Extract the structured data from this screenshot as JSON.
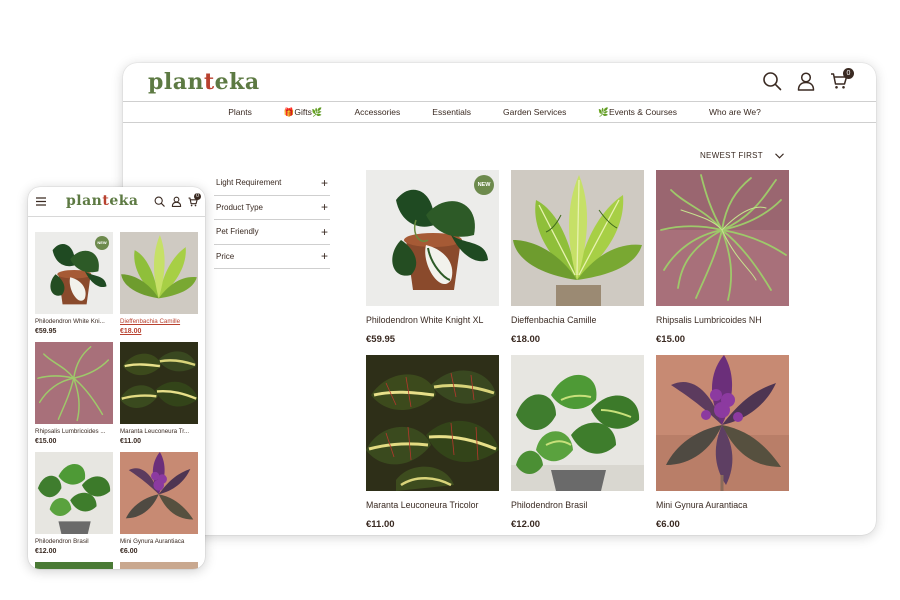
{
  "brand": {
    "name_part1": "plan",
    "name_accent": "t",
    "name_part2": "eka",
    "color_green": "#5d7a43",
    "color_accent": "#b8412f"
  },
  "header": {
    "cart_count": "0"
  },
  "nav": [
    {
      "label": "Plants"
    },
    {
      "label": "🎁Gifts🌿"
    },
    {
      "label": "Accessories"
    },
    {
      "label": "Essentials"
    },
    {
      "label": "Garden Services"
    },
    {
      "label": "🌿Events & Courses"
    },
    {
      "label": "Who are We?"
    }
  ],
  "sort": {
    "label": "NEWEST FIRST"
  },
  "filters": [
    {
      "label": "Light Requirement"
    },
    {
      "label": "Product Type"
    },
    {
      "label": "Pet Friendly"
    },
    {
      "label": "Price"
    }
  ],
  "badge": {
    "new_label": "NEW"
  },
  "products": [
    {
      "name": "Philodendron White Knight XL",
      "price": "€59.95"
    },
    {
      "name": "Dieffenbachia Camille",
      "price": "€18.00"
    },
    {
      "name": "Rhipsalis Lumbricoides NH",
      "price": "€15.00"
    },
    {
      "name": "Maranta Leuconeura Tricolor",
      "price": "€11.00"
    },
    {
      "name": "Philodendron Brasil",
      "price": "€12.00"
    },
    {
      "name": "Mini Gynura Aurantiaca",
      "price": "€6.00"
    }
  ],
  "mobile_products": [
    {
      "name": "Philodendron White Kni...",
      "price": "€59.95"
    },
    {
      "name": "Dieffenbachia Camille",
      "price": "€18.00"
    },
    {
      "name": "Rhipsalis Lumbricoides ...",
      "price": "€15.00"
    },
    {
      "name": "Maranta Leuconeura Tr...",
      "price": "€11.00"
    },
    {
      "name": "Philodendron Brasil",
      "price": "€12.00"
    },
    {
      "name": "Mini Gynura Aurantiaca",
      "price": "€6.00"
    }
  ]
}
